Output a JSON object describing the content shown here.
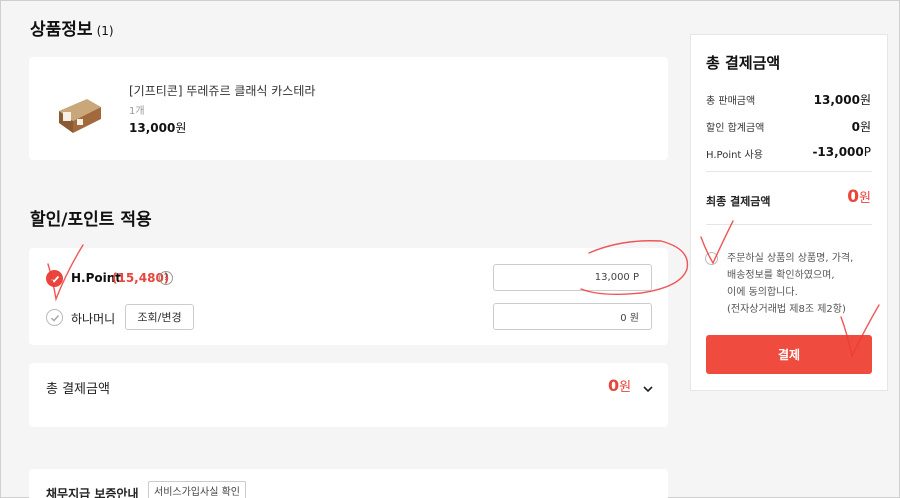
{
  "product_section": {
    "title": "상품정보",
    "count": "(1)"
  },
  "product": {
    "name": "[기프티콘] 뚜레쥬르 클래식 카스테라",
    "quantity": "1개",
    "price": "13,000",
    "price_unit": "원"
  },
  "discount_section": {
    "title": "할인/포인트 적용"
  },
  "points": {
    "hpoint_label": "H.Point",
    "hpoint_available": "(15,480)",
    "help": "?",
    "hpoint_value": "13,000 P",
    "hanamoney_label": "하나머니",
    "lookup_button": "조회/변경",
    "hanamoney_value": "0 원"
  },
  "left_total": {
    "label": "총 결제금액",
    "amount": "0",
    "unit": "원"
  },
  "guarantee": {
    "title": "채무지급 보증안내",
    "button": "서비스가입사실 확인"
  },
  "summary": {
    "title": "총 결제금액",
    "rows": [
      {
        "label": "총 판매금액",
        "value": "13,000",
        "unit": "원"
      },
      {
        "label": "할인 합계금액",
        "value": "0",
        "unit": "원"
      },
      {
        "label": "H.Point 사용",
        "value": "-13,000",
        "unit": "P"
      }
    ],
    "final_label": "최종 결제금액",
    "final_value": "0",
    "final_unit": "원",
    "agreement_lines": [
      "주문하실 상품의 상품명, 가격,",
      "배송정보를 확인하였으며,",
      "이에 동의합니다.",
      "(전자상거래법 제8조 제2항)"
    ],
    "pay_button": "결제"
  },
  "colors": {
    "accent": "#e8453c",
    "pay_button": "#f04b3f"
  }
}
